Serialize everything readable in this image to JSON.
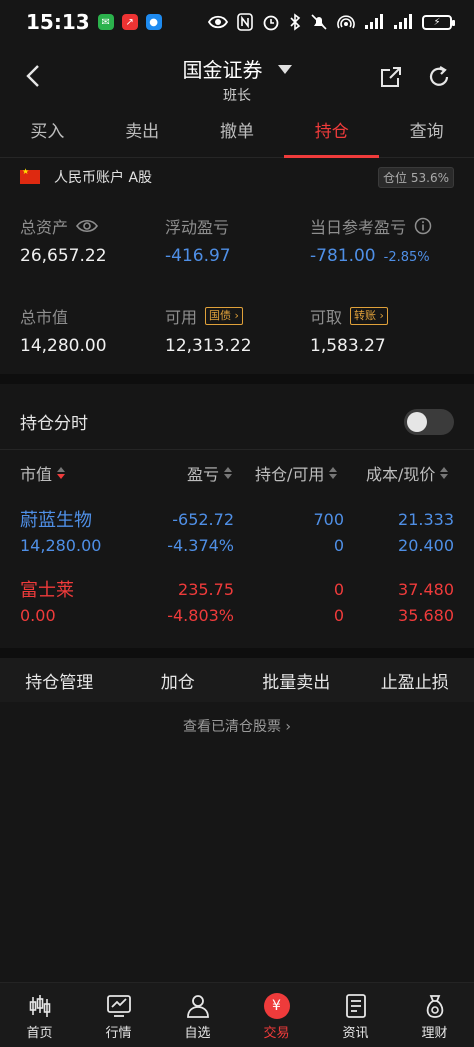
{
  "status_bar": {
    "time": "15:13",
    "battery": "⚡"
  },
  "header": {
    "title": "国金证券",
    "subtitle": "班长"
  },
  "tabs": [
    {
      "label": "买入"
    },
    {
      "label": "卖出"
    },
    {
      "label": "撤单"
    },
    {
      "label": "持仓"
    },
    {
      "label": "查询"
    }
  ],
  "account": {
    "name": "人民币账户 A股",
    "position_label": "仓位",
    "position_value": "53.6%"
  },
  "summary": {
    "total_assets": {
      "label": "总资产",
      "value": "26,657.22"
    },
    "floating_pl": {
      "label": "浮动盈亏",
      "value": "-416.97"
    },
    "daily_pl": {
      "label": "当日参考盈亏",
      "value": "-781.00",
      "pct": "-2.85%"
    },
    "market_value": {
      "label": "总市值",
      "value": "14,280.00"
    },
    "available": {
      "label": "可用",
      "tag": "国债",
      "value": "12,313.22"
    },
    "withdrawable": {
      "label": "可取",
      "tag": "转账",
      "value": "1,583.27"
    }
  },
  "timeshare": {
    "label": "持仓分时",
    "enabled": false
  },
  "table": {
    "headers": {
      "market_value": "市值",
      "pl": "盈亏",
      "holding": "持仓/可用",
      "cost": "成本/现价"
    },
    "rows": [
      {
        "name": "蔚蓝生物",
        "market_value": "14,280.00",
        "pl": "-652.72",
        "pl_pct": "-4.374%",
        "holding": "700",
        "available": "0",
        "cost": "21.333",
        "price": "20.400"
      },
      {
        "name": "富士莱",
        "market_value": "0.00",
        "pl": "235.75",
        "pl_pct": "-4.803%",
        "holding": "0",
        "available": "0",
        "cost": "37.480",
        "price": "35.680"
      }
    ]
  },
  "actions": [
    {
      "label": "持仓管理"
    },
    {
      "label": "加仓"
    },
    {
      "label": "批量卖出"
    },
    {
      "label": "止盈止损"
    }
  ],
  "cleared_link": "查看已清仓股票",
  "bottom_nav": [
    {
      "label": "首页"
    },
    {
      "label": "行情"
    },
    {
      "label": "自选"
    },
    {
      "label": "交易",
      "icon_text": "¥"
    },
    {
      "label": "资讯"
    },
    {
      "label": "理财"
    }
  ],
  "colors": {
    "accent": "#ef3b3b",
    "blue": "#4f8fe6",
    "background": "#161616"
  }
}
